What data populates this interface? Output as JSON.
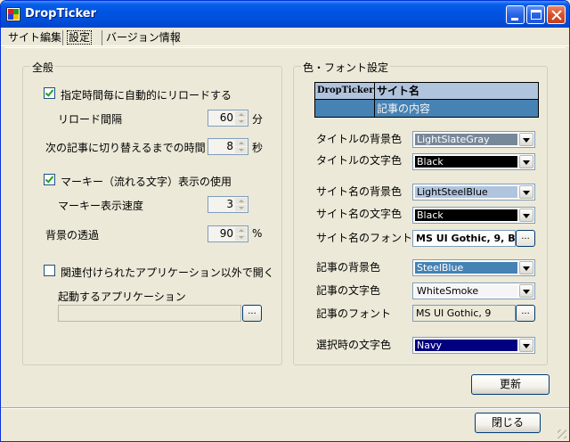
{
  "window": {
    "title": "DropTicker"
  },
  "tabs": [
    {
      "label": "サイト編集"
    },
    {
      "label": "設定"
    },
    {
      "label": "バージョン情報"
    }
  ],
  "general": {
    "legend": "全般",
    "auto_reload": {
      "label": "指定時間毎に自動的にリロードする",
      "checked": true
    },
    "reload_interval": {
      "label": "リロード間隔",
      "value": "60",
      "unit": "分"
    },
    "switch_time": {
      "label": "次の記事に切り替えるまでの時間",
      "value": "8",
      "unit": "秒"
    },
    "marquee": {
      "label": "マーキー（流れる文字）表示の使用",
      "checked": true
    },
    "marquee_speed": {
      "label": "マーキー表示速度",
      "value": "3"
    },
    "opacity": {
      "label": "背景の透過",
      "value": "90",
      "unit": "%"
    },
    "open_other": {
      "label": "関連付けられたアプリケーション以外で開く",
      "checked": false
    },
    "launch_app": {
      "label": "起動するアプリケーション",
      "value": "",
      "browse_label": "..."
    }
  },
  "colors": {
    "legend": "色・フォント設定",
    "preview": {
      "site_text": "DropTicker",
      "title_text": "サイト名",
      "content_text": "記事の内容"
    },
    "title_bg": {
      "label": "タイトルの背景色",
      "value": "LightSlateGray",
      "color": "#778899",
      "text_color": "#FFFFFF"
    },
    "title_fg": {
      "label": "タイトルの文字色",
      "value": "Black",
      "color": "#000000",
      "text_color": "#FFFFFF"
    },
    "site_bg": {
      "label": "サイト名の背景色",
      "value": "LightSteelBlue",
      "color": "#B0C4DE",
      "text_color": "#000000"
    },
    "site_fg": {
      "label": "サイト名の文字色",
      "value": "Black",
      "color": "#000000",
      "text_color": "#FFFFFF"
    },
    "site_font": {
      "label": "サイト名のフォント",
      "value": "MS UI Gothic, 9, B",
      "browse_label": "..."
    },
    "content_bg": {
      "label": "記事の背景色",
      "value": "SteelBlue",
      "color": "#4682B4",
      "text_color": "#FFFFFF"
    },
    "content_fg": {
      "label": "記事の文字色",
      "value": "WhiteSmoke",
      "color": "#F5F5F5",
      "text_color": "#000000"
    },
    "content_font": {
      "label": "記事のフォント",
      "value": "MS UI Gothic, 9",
      "browse_label": "..."
    },
    "selected_fg": {
      "label": "選択時の文字色",
      "value": "Navy",
      "color": "#000080",
      "text_color": "#FFFFFF"
    }
  },
  "buttons": {
    "update": "更新",
    "close": "閉じる"
  }
}
